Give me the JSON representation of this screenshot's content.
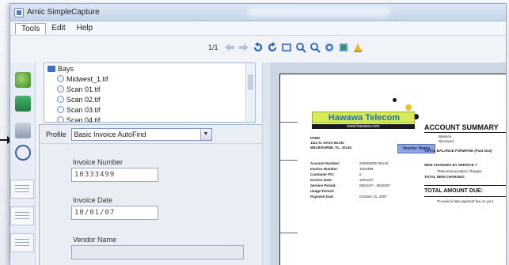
{
  "window": {
    "title": "Arnic SimpleCapture"
  },
  "menu": {
    "items": [
      "Tools",
      "Edit",
      "Help"
    ]
  },
  "toolbar": {
    "page_indicator": "1/1",
    "icons": [
      "back-arrow-icon",
      "forward-arrow-icon",
      "rotate-left-icon",
      "rotate-right-icon",
      "select-rect-icon",
      "zoom-in-icon",
      "zoom-out-icon",
      "fit-page-icon",
      "fit-width-icon",
      "highlight-icon"
    ]
  },
  "tree": {
    "items": [
      {
        "label": "Bays",
        "type": "folder"
      },
      {
        "label": "Midwest_1.tif",
        "type": "file"
      },
      {
        "label": "Scan 01.tif",
        "type": "file"
      },
      {
        "label": "Scan 02.tif",
        "type": "file"
      },
      {
        "label": "Scan 03.tif",
        "type": "file"
      },
      {
        "label": "Scan 04.tif",
        "type": "file"
      }
    ]
  },
  "profile": {
    "label": "Profile",
    "value": "Basic Invoice AutoFind"
  },
  "fields": {
    "invoice_number": {
      "label": "Invoice Number",
      "value": "10333499"
    },
    "invoice_date": {
      "label": "Invoice Date",
      "value": "10/01/07"
    },
    "vendor_name": {
      "label": "Vendor Name",
      "value": ""
    }
  },
  "document": {
    "logo": "Hawawa Telecom",
    "logo_sub": "www.hawawa.com",
    "account_summary": "ACCOUNT SUMMARY",
    "vendor_tag": "Vendor Name",
    "address": [
      "PARK",
      "1111 N. NASA BLVD.",
      "MELBOURNE, FL. 32140"
    ],
    "details": [
      {
        "k": "Account Number:",
        "v": "230000000 00144"
      },
      {
        "k": "Invoice Number:",
        "v": "1003499"
      },
      {
        "k": "Customer PO:",
        "v": "0"
      },
      {
        "k": "Invoice Date:",
        "v": "10/01/07"
      },
      {
        "k": "Service Period:",
        "v": "09/01/07 - 09/30/07"
      },
      {
        "k": "Usage Period:",
        "v": ""
      },
      {
        "k": "Payment Due:",
        "v": "October 31, 2007"
      }
    ],
    "summary_lines": [
      "Balance",
      "Received",
      "TOTAL BALANCE FORWARD (Past Due)"
    ],
    "charges_title": "NEW CHARGES BY SERVICE T",
    "charges_lines": [
      "Telecommunication Charges",
      "TOTAL NEW CHARGES:"
    ],
    "total_due": "TOTAL AMOUNT DUE:",
    "note": "To avoid a late payment fee on your"
  },
  "colors": {
    "logo_bg": "#d6ea58",
    "logo_text": "#1f6fa8",
    "vendor_highlight": "#8ea4e0",
    "folder": "#3d6fd0"
  }
}
